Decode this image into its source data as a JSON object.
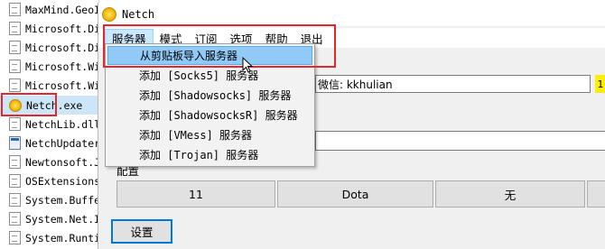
{
  "file_list": [
    {
      "name": "MaxMind.GeoIP",
      "icon": "file-icon"
    },
    {
      "name": "Microsoft.Diag",
      "icon": "file-icon"
    },
    {
      "name": "Microsoft.Diag",
      "icon": "file-icon"
    },
    {
      "name": "Microsoft.Win",
      "icon": "file-icon"
    },
    {
      "name": "Microsoft.Win",
      "icon": "file-icon"
    },
    {
      "name": "Netch.exe",
      "icon": "netch-app-icon"
    },
    {
      "name": "NetchLib.dll",
      "icon": "file-icon"
    },
    {
      "name": "NetchUpdater.",
      "icon": "window-app-icon"
    },
    {
      "name": "Newtonsoft.Js",
      "icon": "file-icon"
    },
    {
      "name": "OSExtensions.",
      "icon": "file-icon"
    },
    {
      "name": "System.Buffer",
      "icon": "file-icon"
    },
    {
      "name": "System.Net.IP",
      "icon": "file-icon"
    },
    {
      "name": "System.Runtim",
      "icon": "file-icon"
    }
  ],
  "window": {
    "title": "Netch",
    "menu": [
      "服务器",
      "模式",
      "订阅",
      "选项",
      "帮助",
      "退出"
    ],
    "wechat_label": "微信: kkhulian",
    "yellow_char": "1",
    "config_label": "配置",
    "buttons": [
      "11",
      "Dota",
      "无"
    ],
    "settings_button": "设置"
  },
  "dropdown": {
    "items": [
      "从剪贴板导入服务器",
      "添加 [Socks5] 服务器",
      "添加 [Shadowsocks] 服务器",
      "添加 [ShadowsocksR] 服务器",
      "添加 [VMess] 服务器",
      "添加 [Trojan] 服务器"
    ]
  },
  "colors": {
    "highlight": "#91c9f7",
    "annotation_red": "#e0282e",
    "accent_blue": "#0078d7"
  }
}
